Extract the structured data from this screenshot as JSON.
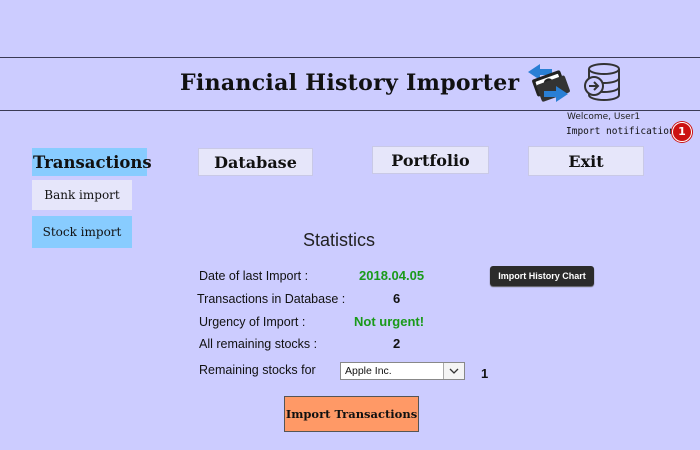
{
  "app": {
    "title": "Financial History Importer"
  },
  "user": {
    "welcome": "Welcome, User1",
    "notification_text": "Import notification",
    "notification_count": "1"
  },
  "nav": {
    "transactions": "Transactions",
    "database": "Database",
    "portfolio": "Portfolio",
    "exit": "Exit"
  },
  "subnav": {
    "bank_import": "Bank import",
    "stock_import": "Stock import"
  },
  "stats": {
    "title": "Statistics",
    "last_import_label": "Date of last Import :",
    "last_import_value": "2018.04.05",
    "tx_count_label": "Transactions in Database :",
    "tx_count_value": "6",
    "urgency_label": "Urgency of Import :",
    "urgency_value": "Not urgent!",
    "remaining_label": "All remaining stocks :",
    "remaining_value": "2",
    "remaining_for_label": "Remaining stocks for",
    "remaining_for_selected": "Apple Inc.",
    "remaining_for_value": "1",
    "chart_button": "Import History Chart"
  },
  "actions": {
    "import_button": "Import Transactions"
  },
  "colors": {
    "background": "#ccccff",
    "active_tab": "#88ccff",
    "import_button": "#ff9966",
    "success_text": "#1a9a1a",
    "badge": "#cc1111"
  },
  "icons": [
    "money-transfer-icon",
    "database-import-icon",
    "chevron-down-icon"
  ]
}
